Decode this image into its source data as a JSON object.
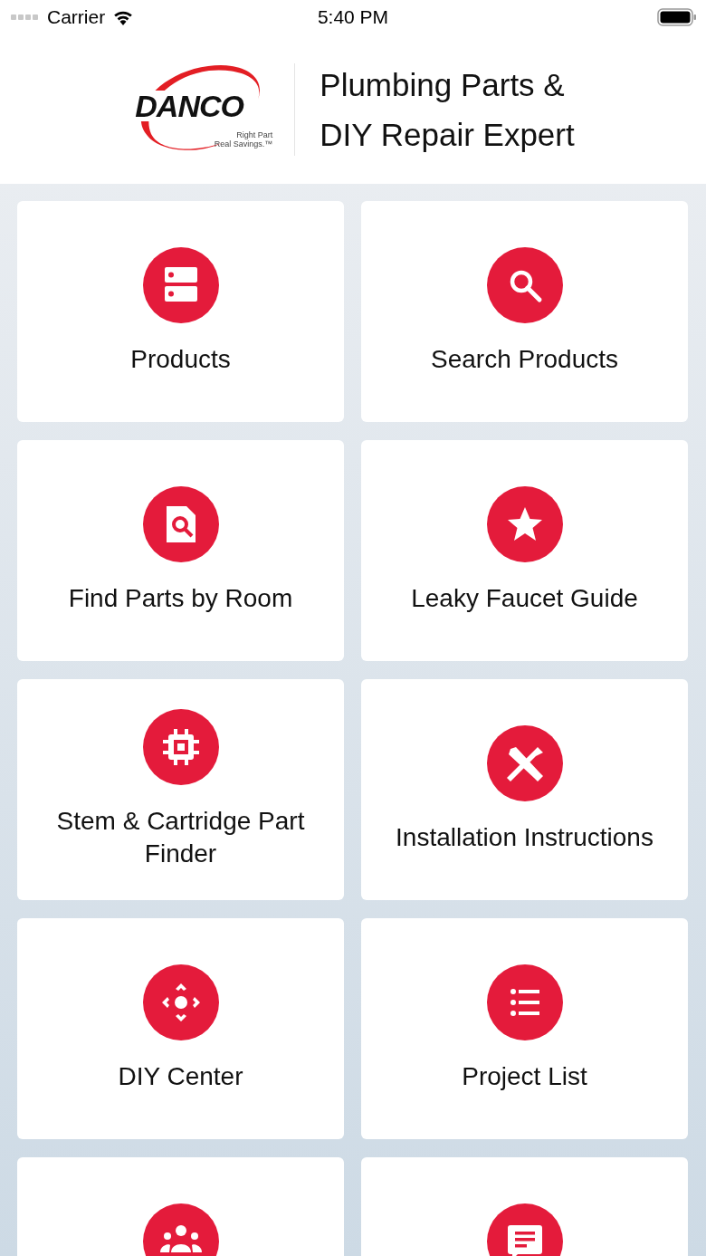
{
  "status_bar": {
    "carrier": "Carrier",
    "time": "5:40 PM"
  },
  "header": {
    "logo": {
      "wordmark": "DANCO",
      "tagline": [
        "Right Part",
        "Real Savings.™"
      ]
    },
    "title_lines": [
      "Plumbing Parts &",
      "DIY Repair Expert"
    ]
  },
  "tiles": [
    {
      "kind": "menu",
      "label": "Products"
    },
    {
      "kind": "menu",
      "label": "Search Products"
    },
    {
      "kind": "menu",
      "label": "Find Parts by Room"
    },
    {
      "kind": "menu",
      "label": "Leaky Faucet Guide"
    },
    {
      "kind": "menu",
      "label": "Stem & Cartridge Part Finder"
    },
    {
      "kind": "menu",
      "label": "Installation Instructions"
    },
    {
      "kind": "menu",
      "label": "DIY Center"
    },
    {
      "kind": "menu",
      "label": "Project List"
    },
    {
      "kind": "menu"
    },
    {
      "kind": "menu"
    }
  ]
}
